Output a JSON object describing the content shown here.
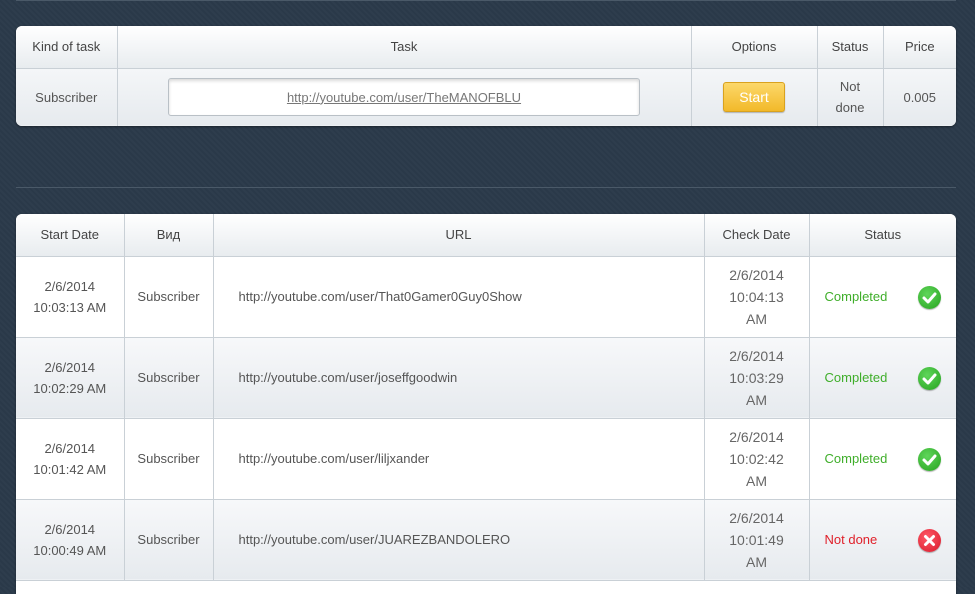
{
  "task_table": {
    "headers": {
      "kind": "Kind of task",
      "task": "Task",
      "options": "Options",
      "status": "Status",
      "price": "Price"
    },
    "row": {
      "kind": "Subscriber",
      "url": "http://youtube.com/user/TheMANOFBLU",
      "start_label": "Start",
      "status_line1": "Not",
      "status_line2": "done",
      "price": "0.005"
    }
  },
  "history_table": {
    "headers": {
      "start_date": "Start Date",
      "kind": "Вид",
      "url": "URL",
      "check_date": "Check Date",
      "status": "Status"
    },
    "rows": [
      {
        "start_date": "2/6/2014",
        "start_time": "10:03:13 AM",
        "kind": "Subscriber",
        "url": "http://youtube.com/user/That0Gamer0Guy0Show",
        "check_date": "2/6/2014",
        "check_time": "10:04:13",
        "check_ampm": "AM",
        "status": "Completed",
        "status_icon": "check-circle-icon"
      },
      {
        "start_date": "2/6/2014",
        "start_time": "10:02:29 AM",
        "kind": "Subscriber",
        "url": "http://youtube.com/user/joseffgoodwin",
        "check_date": "2/6/2014",
        "check_time": "10:03:29",
        "check_ampm": "AM",
        "status": "Completed",
        "status_icon": "check-circle-icon"
      },
      {
        "start_date": "2/6/2014",
        "start_time": "10:01:42 AM",
        "kind": "Subscriber",
        "url": "http://youtube.com/user/liljxander",
        "check_date": "2/6/2014",
        "check_time": "10:02:42",
        "check_ampm": "AM",
        "status": "Completed",
        "status_icon": "check-circle-icon"
      },
      {
        "start_date": "2/6/2014",
        "start_time": "10:00:49 AM",
        "kind": "Subscriber",
        "url": "http://youtube.com/user/JUAREZBANDOLERO",
        "check_date": "2/6/2014",
        "check_time": "10:01:49",
        "check_ampm": "AM",
        "status": "Not done",
        "status_icon": "x-circle-icon"
      }
    ]
  },
  "colors": {
    "background": "#2b3a4a",
    "start_button": "#f5c236",
    "completed": "#3fae2a",
    "not_done": "#e0202a"
  }
}
